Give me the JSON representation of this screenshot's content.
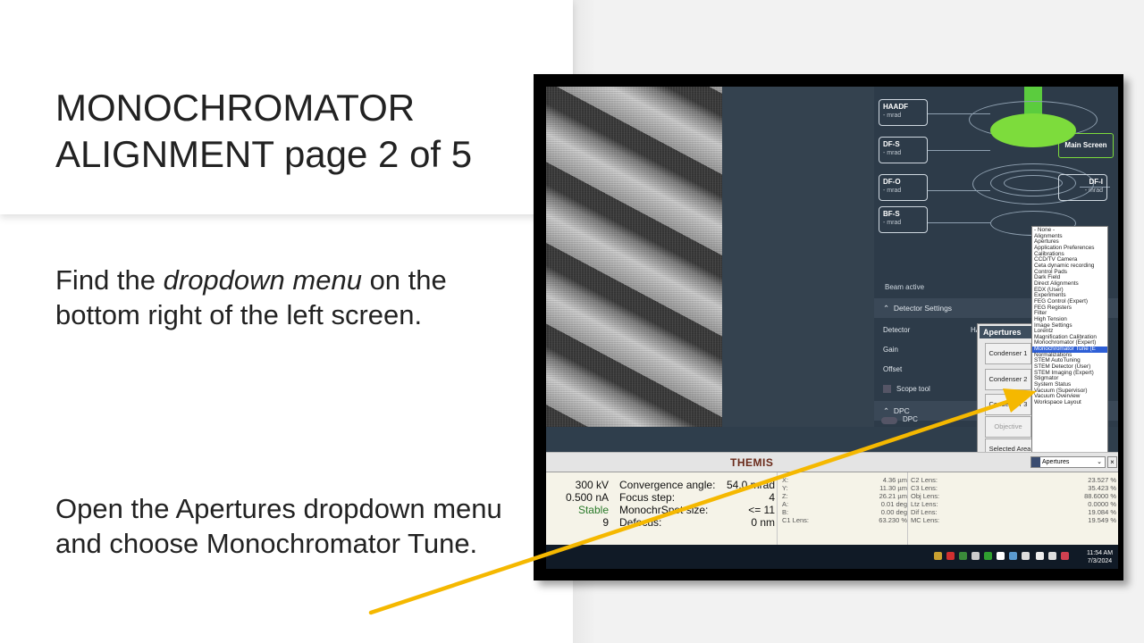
{
  "slide": {
    "title": "MONOCHROMATOR ALIGNMENT page 2 of 5",
    "instruction1_pre": "Find the ",
    "instruction1_em": "dropdown menu",
    "instruction1_post": " on the bottom right of the left screen.",
    "instruction2": "Open the Apertures dropdown menu and choose Monochromator Tune."
  },
  "detectors": {
    "haadf": {
      "name": "HAADF",
      "value": "- mrad"
    },
    "dfs": {
      "name": "DF-S",
      "value": "- mrad"
    },
    "dfo": {
      "name": "DF-O",
      "value": "- mrad"
    },
    "bfs": {
      "name": "BF-S",
      "value": "- mrad"
    },
    "dfi": {
      "name": "DF-I",
      "value": "- mrad"
    },
    "main_screen": "Main Screen",
    "beam_active": "Beam active",
    "detector_settings": "Detector Settings",
    "detector_label": "Detector",
    "detector_value": "HA",
    "gain": "Gain",
    "offset": "Offset",
    "scope_tool": "Scope tool",
    "dpc_section": "DPC",
    "dpc_toggle": "DPC"
  },
  "apertures_panel": {
    "title": "Apertures",
    "condenser1": "Condenser 1",
    "condenser2": "Condenser 2",
    "condenser3": "Condenser 3",
    "objective": "Objective",
    "selected_area": "Selected Area"
  },
  "menu": {
    "items": [
      "- None -",
      "Alignments",
      "Apertures",
      "Application Preferences",
      "Calibrations",
      "CCD/TV Camera",
      "Ceta dynamic recording",
      "Control Pads",
      "Dark Field",
      "Direct Alignments",
      "EDX (User)",
      "Experiments",
      "FEG Control (Expert)",
      "FEG Registers",
      "Filter",
      "High Tension",
      "Image Settings",
      "Lorentz",
      "Magnification Calibration",
      "Monochromator (Expert)",
      "Monochromator Tune (E",
      "Normalizations",
      "STEM AutoTuning",
      "STEM Detector (User)",
      "STEM Imaging (Expert)",
      "Stigmator",
      "System Status",
      "Vacuum (Supervisor)",
      "Vacuum Overview",
      "Workspace Layout"
    ],
    "selected_index": 20
  },
  "bar": {
    "themis": "THEMIS",
    "select_value": "Apertures",
    "close": "×"
  },
  "status": {
    "col1": [
      "300 kV",
      "0.500 nA",
      "Stable",
      "9"
    ],
    "col2": [
      "Convergence angle:",
      "Focus step:",
      "MonochrSpot size:",
      "Defocus:"
    ],
    "col3": [
      "54.0 mrad",
      "4",
      "<= 11",
      "0 nm"
    ],
    "col4_labels": [
      "X:",
      "Y:",
      "Z:",
      "A:",
      "B:",
      "C1 Lens:"
    ],
    "col4_values": [
      "4.36 µm",
      "11.30 µm",
      "26.21 µm",
      "0.01 deg",
      "0.00 deg",
      "63.230 %"
    ],
    "col5_labels": [
      "C2 Lens:",
      "C3 Lens:",
      "Obj Lens:",
      "Ltz Lens:",
      "Dif Lens:",
      "MC Lens:"
    ],
    "col5_values": [
      "23.527 %",
      "35.423 %",
      "88.6000 %",
      "0.0000 %",
      "19.084 %",
      "19.549 %"
    ]
  },
  "taskbar": {
    "time": "11:54 AM",
    "date": "7/3/2024"
  },
  "colors": {
    "arrow": "#f5b800",
    "selected": "#2e5fd6",
    "green": "#7ddc3c"
  }
}
